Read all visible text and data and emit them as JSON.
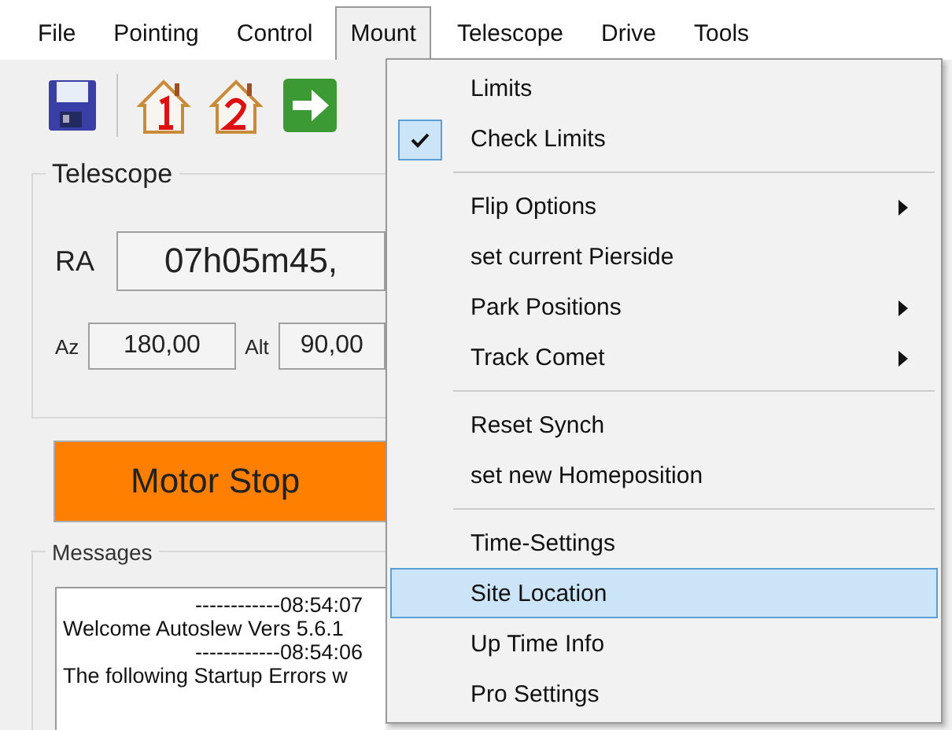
{
  "menu_bar": [
    {
      "label": "File",
      "selected": false
    },
    {
      "label": "Pointing",
      "selected": false
    },
    {
      "label": "Control",
      "selected": false
    },
    {
      "label": "Mount",
      "selected": true
    },
    {
      "label": "Telescope",
      "selected": false
    },
    {
      "label": "Drive",
      "selected": false
    },
    {
      "label": "Tools",
      "selected": false
    }
  ],
  "telescope": {
    "title": "Telescope",
    "ra_label": "RA",
    "ra_value": "07h05m45,",
    "az_label": "Az",
    "az_value": "180,00",
    "alt_label": "Alt",
    "alt_value": "90,00"
  },
  "motor_button": "Motor Stop",
  "messages": {
    "title": "Messages",
    "lines": [
      {
        "text": "------------08:54:07",
        "kind": "time"
      },
      {
        "text": "Welcome Autoslew Vers 5.6.1",
        "kind": "text"
      },
      {
        "text": "------------08:54:06",
        "kind": "time"
      },
      {
        "text": "The following Startup Errors w",
        "kind": "text"
      }
    ]
  },
  "mount_menu": [
    {
      "kind": "item",
      "label": "Limits",
      "checked": false,
      "submenu": false,
      "selected": false
    },
    {
      "kind": "item",
      "label": "Check Limits",
      "checked": true,
      "submenu": false,
      "selected": false
    },
    {
      "kind": "separator"
    },
    {
      "kind": "item",
      "label": "Flip Options",
      "checked": false,
      "submenu": true,
      "selected": false
    },
    {
      "kind": "item",
      "label": "set current Pierside",
      "checked": false,
      "submenu": false,
      "selected": false
    },
    {
      "kind": "item",
      "label": "Park Positions",
      "checked": false,
      "submenu": true,
      "selected": false
    },
    {
      "kind": "item",
      "label": "Track Comet",
      "checked": false,
      "submenu": true,
      "selected": false
    },
    {
      "kind": "separator"
    },
    {
      "kind": "item",
      "label": "Reset Synch",
      "checked": false,
      "submenu": false,
      "selected": false
    },
    {
      "kind": "item",
      "label": "set new Homeposition",
      "checked": false,
      "submenu": false,
      "selected": false
    },
    {
      "kind": "separator"
    },
    {
      "kind": "item",
      "label": "Time-Settings",
      "checked": false,
      "submenu": false,
      "selected": false
    },
    {
      "kind": "item",
      "label": "Site Location",
      "checked": false,
      "submenu": false,
      "selected": true
    },
    {
      "kind": "item",
      "label": "Up Time Info",
      "checked": false,
      "submenu": false,
      "selected": false
    },
    {
      "kind": "item",
      "label": "Pro Settings",
      "checked": false,
      "submenu": false,
      "selected": false
    }
  ]
}
